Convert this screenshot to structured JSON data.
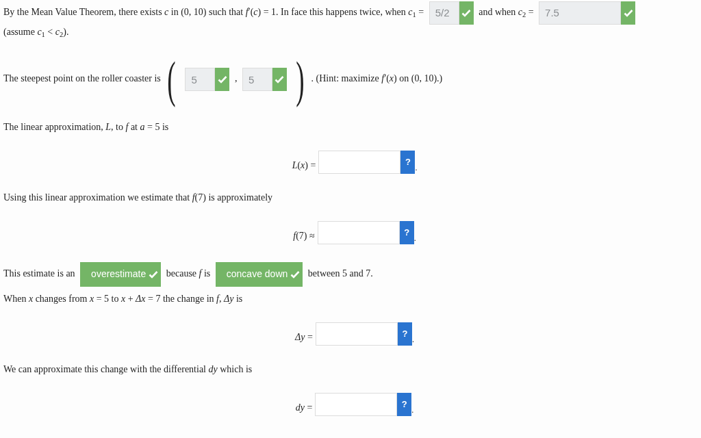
{
  "blocks": [
    {
      "kind": "line",
      "parts": [
        {
          "kind": "text",
          "text": "By the Mean Value Theorem, there exists *c* in (0, 10) such that *f*′(*c*) = 1. In face this happens twice, when *c*$_{1}$ ="
        },
        {
          "kind": "field",
          "value": "5/2",
          "correct": true
        },
        {
          "kind": "text",
          "text": "and when *c*$_{2}$ ="
        },
        {
          "kind": "wide_field",
          "value": "7.5",
          "correct": true
        }
      ]
    },
    {
      "kind": "line",
      "parts": [
        {
          "kind": "text",
          "text": "(assume *c*$_{1}$ < *c*$_{2}$)."
        }
      ]
    },
    {
      "kind": "line",
      "parts": [
        {
          "kind": "text",
          "text": "The steepest point on the roller coaster is"
        },
        {
          "kind": "paren",
          "text": "("
        },
        {
          "kind": "field",
          "value": "5",
          "correct": true
        },
        {
          "kind": "text",
          "text": ","
        },
        {
          "kind": "field",
          "value": "5",
          "correct": true
        },
        {
          "kind": "paren",
          "text": ")"
        },
        {
          "kind": "text",
          "text": ". (Hint: maximize *f*′(*x*) on (0, 10).)"
        }
      ]
    },
    {
      "kind": "line",
      "parts": [
        {
          "kind": "text",
          "text": "The linear approximation, *L*, to *f* at *a* = 5 is"
        }
      ]
    },
    {
      "kind": "display",
      "label": "*L*(*x*) =",
      "hint": "?",
      "end": "."
    },
    {
      "kind": "line",
      "parts": [
        {
          "kind": "text",
          "text": "Using this linear approximation we estimate that *f*(7) is approximately"
        }
      ]
    },
    {
      "kind": "display",
      "label": "*f*(7) ≈",
      "hint": "?",
      "end": "."
    },
    {
      "kind": "line",
      "parts": [
        {
          "kind": "text",
          "text": "This estimate is an"
        },
        {
          "kind": "select",
          "value": "overestimate",
          "correct": true
        },
        {
          "kind": "text",
          "text": "because *f* is"
        },
        {
          "kind": "select",
          "value": "concave down",
          "correct": true
        },
        {
          "kind": "text",
          "text": "between 5 and 7."
        }
      ]
    },
    {
      "kind": "line",
      "parts": [
        {
          "kind": "text",
          "text": "When *x* changes from *x* = 5 to *x* + *Δx* = 7 the change in *f*, *Δy* is"
        }
      ]
    },
    {
      "kind": "display",
      "label": "*Δy* =",
      "hint": "?",
      "end": "."
    },
    {
      "kind": "line",
      "parts": [
        {
          "kind": "text",
          "text": "We can approximate this change with the differential *dy* which is"
        }
      ]
    },
    {
      "kind": "display",
      "label": "*dy* =",
      "hint": "?",
      "end": "."
    }
  ]
}
